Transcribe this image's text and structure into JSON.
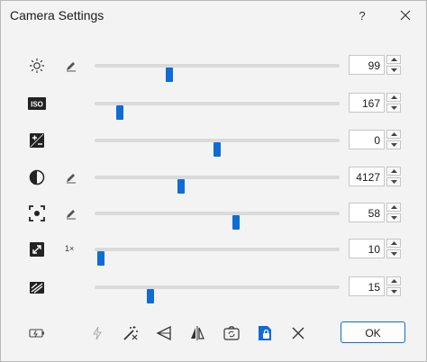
{
  "window": {
    "title": "Camera Settings",
    "help_label": "?"
  },
  "controls": [
    {
      "name": "brightness",
      "icon": "brightness-icon",
      "auto": "pencil-icon",
      "value": "99",
      "level": 0.3
    },
    {
      "name": "iso",
      "icon": "iso-icon",
      "auto": null,
      "value": "167",
      "level": 0.09
    },
    {
      "name": "exposure",
      "icon": "exposure-icon",
      "auto": null,
      "value": "0",
      "level": 0.5
    },
    {
      "name": "contrast",
      "icon": "contrast-icon",
      "auto": "pencil-icon",
      "value": "4127",
      "level": 0.35
    },
    {
      "name": "focus",
      "icon": "focus-icon",
      "auto": "pencil-icon",
      "value": "58",
      "level": 0.58
    },
    {
      "name": "zoom",
      "icon": "zoom-icon",
      "auto_text": "1×",
      "value": "10",
      "level": 0.01
    },
    {
      "name": "hdr",
      "icon": "hdr-icon",
      "auto": null,
      "value": "15",
      "level": 0.22
    }
  ],
  "toolbar": {
    "icons": [
      "battery-icon",
      "flash-icon",
      "magic-wand-icon",
      "flip-horizontal-icon",
      "mirror-icon",
      "camera-rotate-icon",
      "lock-icon",
      "close-icon"
    ],
    "ok_label": "OK"
  },
  "colors": {
    "accent": "#0f6cd6",
    "track": "#dadada",
    "background": "#f3f3f3"
  }
}
